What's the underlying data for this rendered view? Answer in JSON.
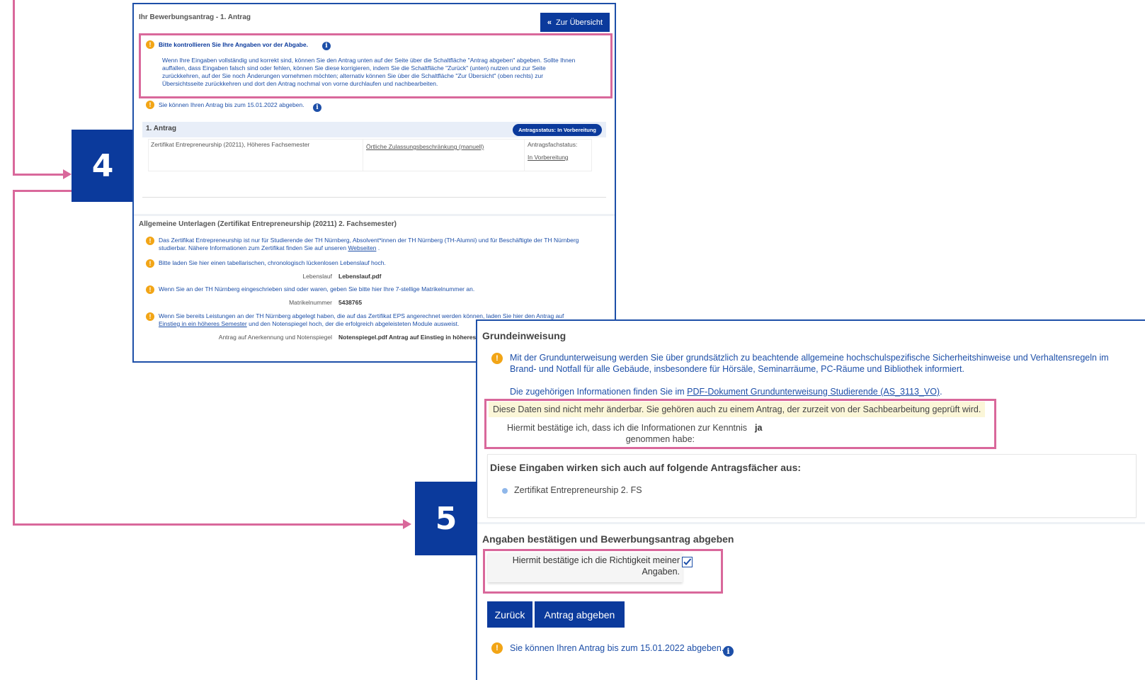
{
  "steps": {
    "step4": "4",
    "step5": "5"
  },
  "panel1": {
    "title": "Ihr Bewerbungsantrag - 1. Antrag",
    "overview_button": "Zur Übersicht",
    "warning_heading": "Bitte kontrollieren Sie Ihre Angaben vor der Abgabe.",
    "warning_body": [
      "Wenn Ihre Eingaben vollständig und korrekt sind, können Sie den Antrag unten auf der Seite über die Schaltfläche \"Antrag abgeben\" abgeben. Sollte Ihnen",
      "auffallen, dass Eingaben falsch sind oder fehlen, können Sie diese korrigieren, indem Sie die Schaltfläche \"Zurück\" (unten) nutzen und zur Seite",
      "zurückkehren, auf der Sie noch Änderungen vornehmen möchten; alternativ können Sie über die Schaltfläche \"Zur Übersicht\" (oben rechts) zur",
      "Übersichtsseite zurückkehren und dort den Antrag nochmal von vorne durchlaufen und nachbearbeiten."
    ],
    "deadline": "Sie können Ihren Antrag bis zum 15.01.2022 abgeben.",
    "antrag_label": "1. Antrag",
    "status_badge": "Antragsstatus: In Vorbereitung",
    "program": "Zertifikat Entrepreneurship (20211), Höheres Fachsemester",
    "restriction_link": "Örtliche Zulassungsbeschränkung (manuell)",
    "fach_status_label": "Antragsfachstatus:",
    "fach_status_value": "In Vorbereitung",
    "docs_heading": "Allgemeine Unterlagen (Zertifikat Entrepreneurship (20211) 2. Fachsemester)",
    "note1_line1": "Das Zertifikat Entrepreneurship ist nur für Studierende der TH Nürnberg, Absolvent*innen der TH Nürnberg (TH-Alumni) und für Beschäftigte der TH Nürnberg",
    "note1_line2": "studierbar. Nähere Informationen zum Zertifikat finden Sie auf unseren",
    "note1_link": "Webseiten",
    "note2": "Bitte laden Sie hier einen tabellarischen, chronologisch lückenlosen Lebenslauf hoch.",
    "cv_label": "Lebenslauf",
    "cv_value": "Lebenslauf.pdf",
    "note3": "Wenn Sie an der TH Nürnberg eingeschrieben sind oder waren, geben Sie bitte hier Ihre 7-stellige Matrikelnummer an.",
    "matrikel_label": "Matrikelnummer",
    "matrikel_value": "5438765",
    "note4_line1": "Wenn Sie bereits Leistungen an der TH Nürnberg abgelegt haben, die auf das Zertifikat EPS angerechnet werden können, laden Sie hier den Antrag auf",
    "note4_link": "Einstieg in ein höheres Semester",
    "note4_line2": "und den Notenspiegel hoch, der die erfolgreich abgeleisteten Module ausweist.",
    "recognition_label": "Antrag auf Anerkennung und Notenspiegel",
    "recognition_value": "Notenspiegel.pdf  Antrag auf Einstieg in höheres"
  },
  "panel2": {
    "heading": "Grundeinweisung",
    "intro_line1": "Mit der Grundunterweisung werden Sie über grundsätzlich zu beachtende allgemeine hochschulspezifische Sicherheitshinweise und Verhaltensregeln im",
    "intro_line2": "Brand- und Notfall für alle Gebäude, insbesondere für Hörsäle, Seminarräume, PC-Räume und Bibliothek informiert.",
    "info_prefix": "Die zugehörigen Informationen finden Sie im",
    "info_link": "PDF-Dokument Grundunterweisung Studierende (AS_3113_VO)",
    "info_suffix": ".",
    "locked_notice": "Diese Daten sind nicht mehr änderbar. Sie gehören auch zu einem Antrag, der zurzeit von der Sachbearbeitung geprüft wird.",
    "confirm_line1": "Hiermit bestätige ich, dass ich die Informationen zur Kenntnis",
    "confirm_line2": "genommen habe:",
    "confirm_value": "ja",
    "affects_heading": "Diese Eingaben wirken sich auch auf folgende Antragsfächer aus:",
    "affects_item": "Zertifikat Entrepreneurship 2. FS",
    "submit_heading": "Angaben bestätigen und Bewerbungsantrag abgeben",
    "checkbox_line1": "Hiermit bestätige ich die Richtigkeit meiner",
    "checkbox_line2": "Angaben.",
    "checkbox_checked": true,
    "back_button": "Zurück",
    "submit_button": "Antrag abgeben",
    "deadline": "Sie können Ihren Antrag bis zum 15.01.2022 abgeben."
  },
  "colors": {
    "brand_blue": "#0b3a9c",
    "highlight_pink": "#d9689b",
    "warning_orange": "#f2a516",
    "locked_yellow": "#fbf6d8"
  },
  "icons": [
    "info-icon",
    "warning-icon",
    "double-chevron-left-icon",
    "checkbox-checked-icon",
    "bullet-icon"
  ]
}
